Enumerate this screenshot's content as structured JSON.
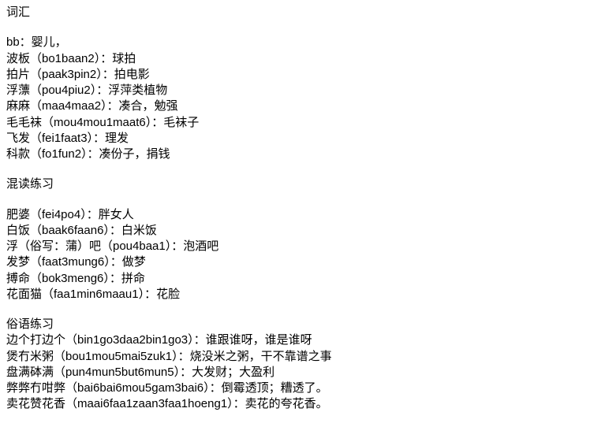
{
  "doc": {
    "title": "词汇",
    "section2_title": "混读练习",
    "section3_title": "俗语练习",
    "vocab": [
      "bb：婴儿，",
      "波板（bo1baan2）：球拍",
      "拍片（paak3pin2）：拍电影",
      "浮薸（pou4piu2）：浮萍类植物",
      "麻麻（maa4maa2）：凑合，勉强",
      "毛毛袜（mou4mou1maat6）：毛袜子",
      "飞发（fei1faat3）：理发",
      "科款（fo1fun2）：凑份子，捐钱"
    ],
    "mixed": [
      "肥婆（fei4po4）：胖女人",
      "白饭（baak6faan6）：白米饭",
      "浮（俗写：蒲）吧（pou4baa1）：泡酒吧",
      "发梦（faat3mung6）：做梦",
      "搏命（bok3meng6）：拼命",
      "花面猫（faa1min6maau1）：花脸"
    ],
    "idioms": [
      "边个打边个（bin1go3daa2bin1go3）：谁跟谁呀，谁是谁呀",
      "煲冇米粥（bou1mou5mai5zuk1）：烧没米之粥，干不靠谱之事",
      "盘满砵满（pun4mun5but6mun5）：大发财；大盈利",
      "弊弊冇咁弊（bai6bai6mou5gam3bai6）：倒霉透顶；糟透了。",
      "卖花赞花香（maai6faa1zaan3faa1hoeng1）：卖花的夸花香。"
    ]
  }
}
